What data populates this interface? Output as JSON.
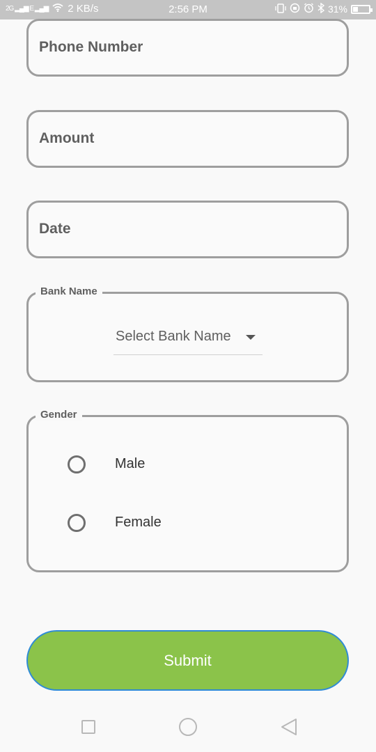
{
  "status_bar": {
    "signal_left": "2G",
    "signal_right": "E",
    "speed": "2 KB/s",
    "time": "2:56 PM",
    "battery": "31%"
  },
  "form": {
    "phone_label": "Phone Number",
    "amount_label": "Amount",
    "date_label": "Date",
    "bank": {
      "legend": "Bank Name",
      "selected": "Select Bank Name"
    },
    "gender": {
      "legend": "Gender",
      "options": [
        "Male",
        "Female"
      ]
    },
    "submit_label": "Submit"
  },
  "colors": {
    "accent": "#8bc34a",
    "submit_border": "#2f8bd6",
    "field_border": "#9e9e9e",
    "status_bar": "#c4c4c4"
  }
}
